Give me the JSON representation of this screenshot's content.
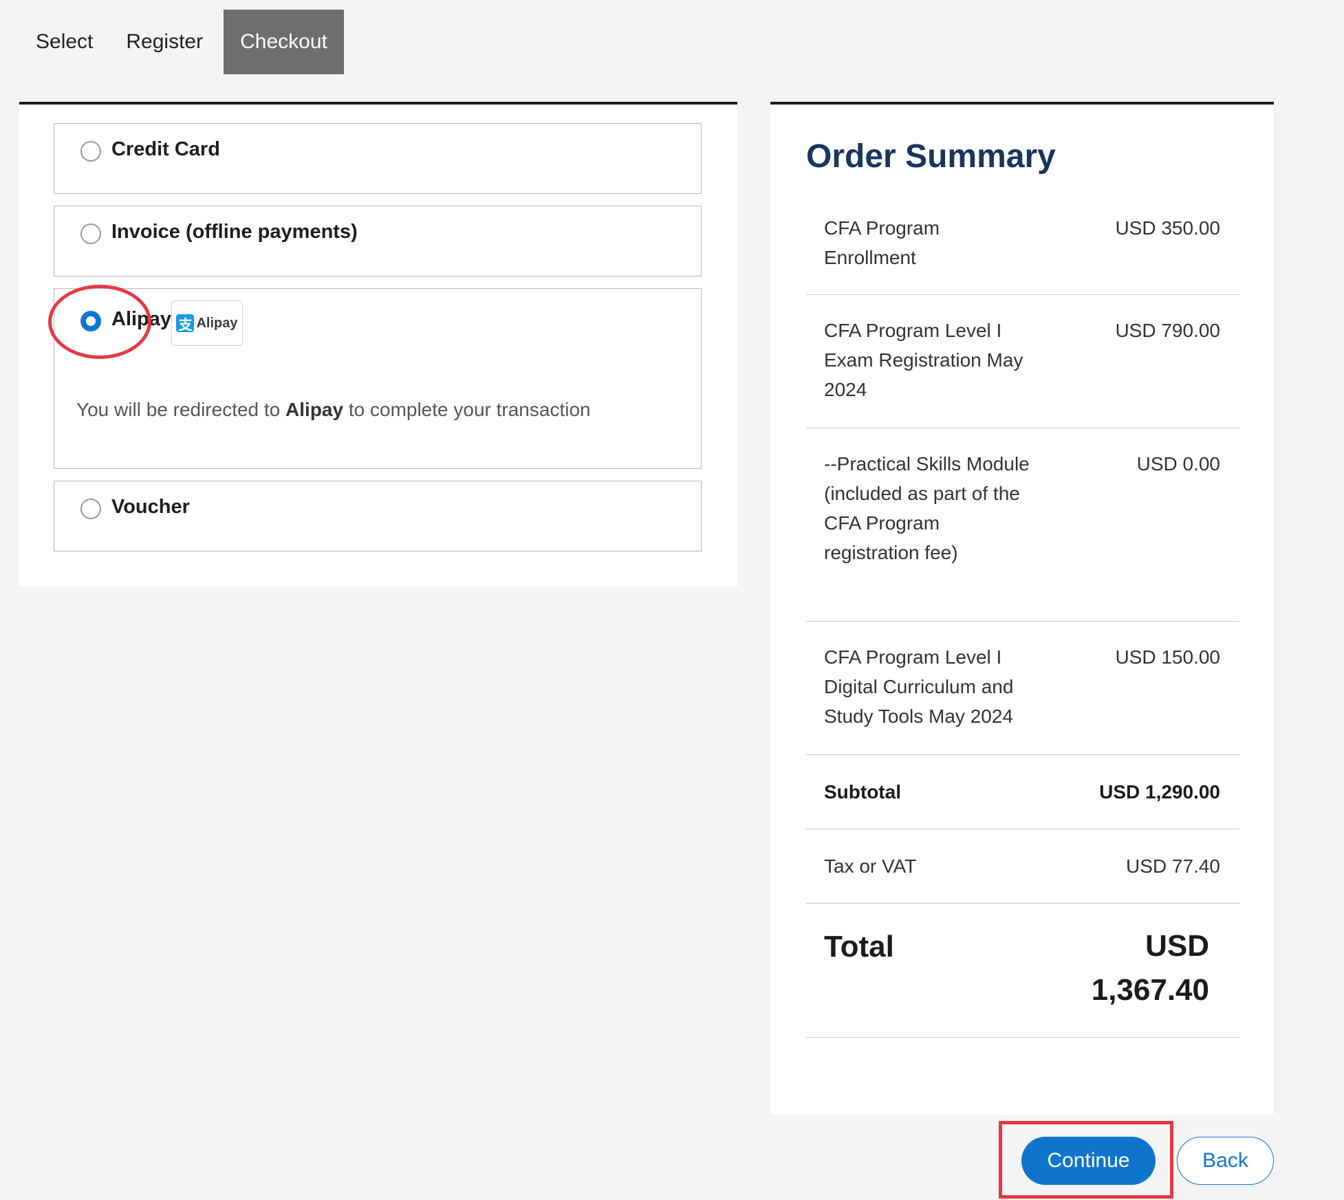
{
  "steps": {
    "select": "Select",
    "register": "Register",
    "checkout": "Checkout"
  },
  "payment": {
    "selected": "alipay",
    "credit_card": "Credit Card",
    "invoice": "Invoice (offline payments)",
    "alipay": "Alipay",
    "alipay_logo_text": "Alipay",
    "redirect_prefix": "You will be redirected to",
    "redirect_target": "Alipay",
    "redirect_suffix": "to complete your transaction",
    "voucher": "Voucher"
  },
  "summary": {
    "title": "Order Summary",
    "items": [
      {
        "label": "CFA Program Enrollment",
        "value": "USD 350.00"
      },
      {
        "label": "CFA Program Level I Exam Registration May 2024",
        "value": "USD 790.00"
      },
      {
        "label": "--Practical Skills Module (included as part of the CFA Program registration fee)",
        "value": "USD 0.00"
      },
      {
        "label": "CFA Program Level I Digital Curriculum and Study Tools May 2024",
        "value": "USD 150.00"
      }
    ],
    "subtotal_label": "Subtotal",
    "subtotal_value": "USD 1,290.00",
    "tax_label": "Tax or VAT",
    "tax_value": "USD 77.40",
    "total_label": "Total",
    "total_value": "USD 1,367.40"
  },
  "buttons": {
    "continue": "Continue",
    "back": "Back"
  },
  "colors": {
    "primary": "#0f75cc",
    "title": "#17355e",
    "annotation": "#e53945",
    "active_step": "#6e6e6e"
  }
}
